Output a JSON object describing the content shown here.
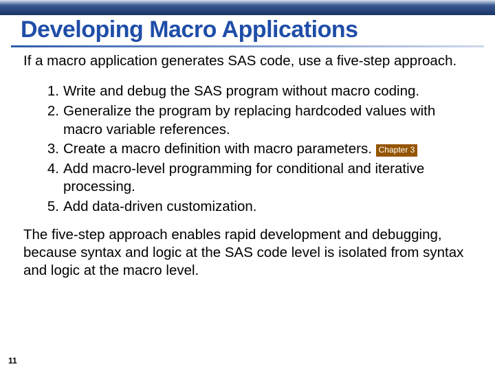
{
  "title": "Developing Macro Applications",
  "intro": "If a macro application generates SAS code, use a five-step approach.",
  "steps": [
    "Write and debug the SAS program without macro coding.",
    "Generalize the program by replacing hardcoded values with macro variable references.",
    "Create a macro definition with macro parameters.",
    "Add macro-level programming for conditional and iterative processing.",
    "Add data-driven customization."
  ],
  "badge": "Chapter 3",
  "closing": "The five-step approach enables rapid development and debugging, because syntax and logic at the SAS code level is isolated from syntax and logic at the macro level.",
  "page_number": "11"
}
